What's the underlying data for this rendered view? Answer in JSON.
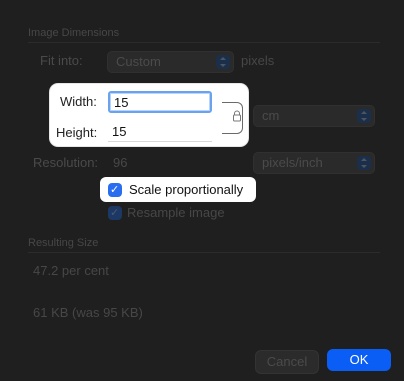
{
  "sections": {
    "image_dimensions": "Image Dimensions",
    "resulting_size": "Resulting Size"
  },
  "fit_into": {
    "label": "Fit into:",
    "value": "Custom",
    "unit": "pixels"
  },
  "width": {
    "label": "Width:",
    "value": "15"
  },
  "height": {
    "label": "Height:",
    "value": "15"
  },
  "size_unit": "cm",
  "resolution": {
    "label": "Resolution:",
    "value": "96",
    "unit": "pixels/inch"
  },
  "scale_proportionally": {
    "label": "Scale proportionally",
    "checked": true
  },
  "resample_image": {
    "label": "Resample image",
    "checked": true
  },
  "result": {
    "percent": "47.2 per cent",
    "file_size": "61 KB (was 95 KB)"
  },
  "buttons": {
    "cancel": "Cancel",
    "ok": "OK"
  },
  "colors": {
    "accent": "#0a5ef5",
    "focus_ring": "#6aa2f0"
  },
  "icons": {
    "lock": "lock-icon",
    "popup_arrows": "chevron-updown-icon",
    "checkmark": "checkmark-icon"
  }
}
